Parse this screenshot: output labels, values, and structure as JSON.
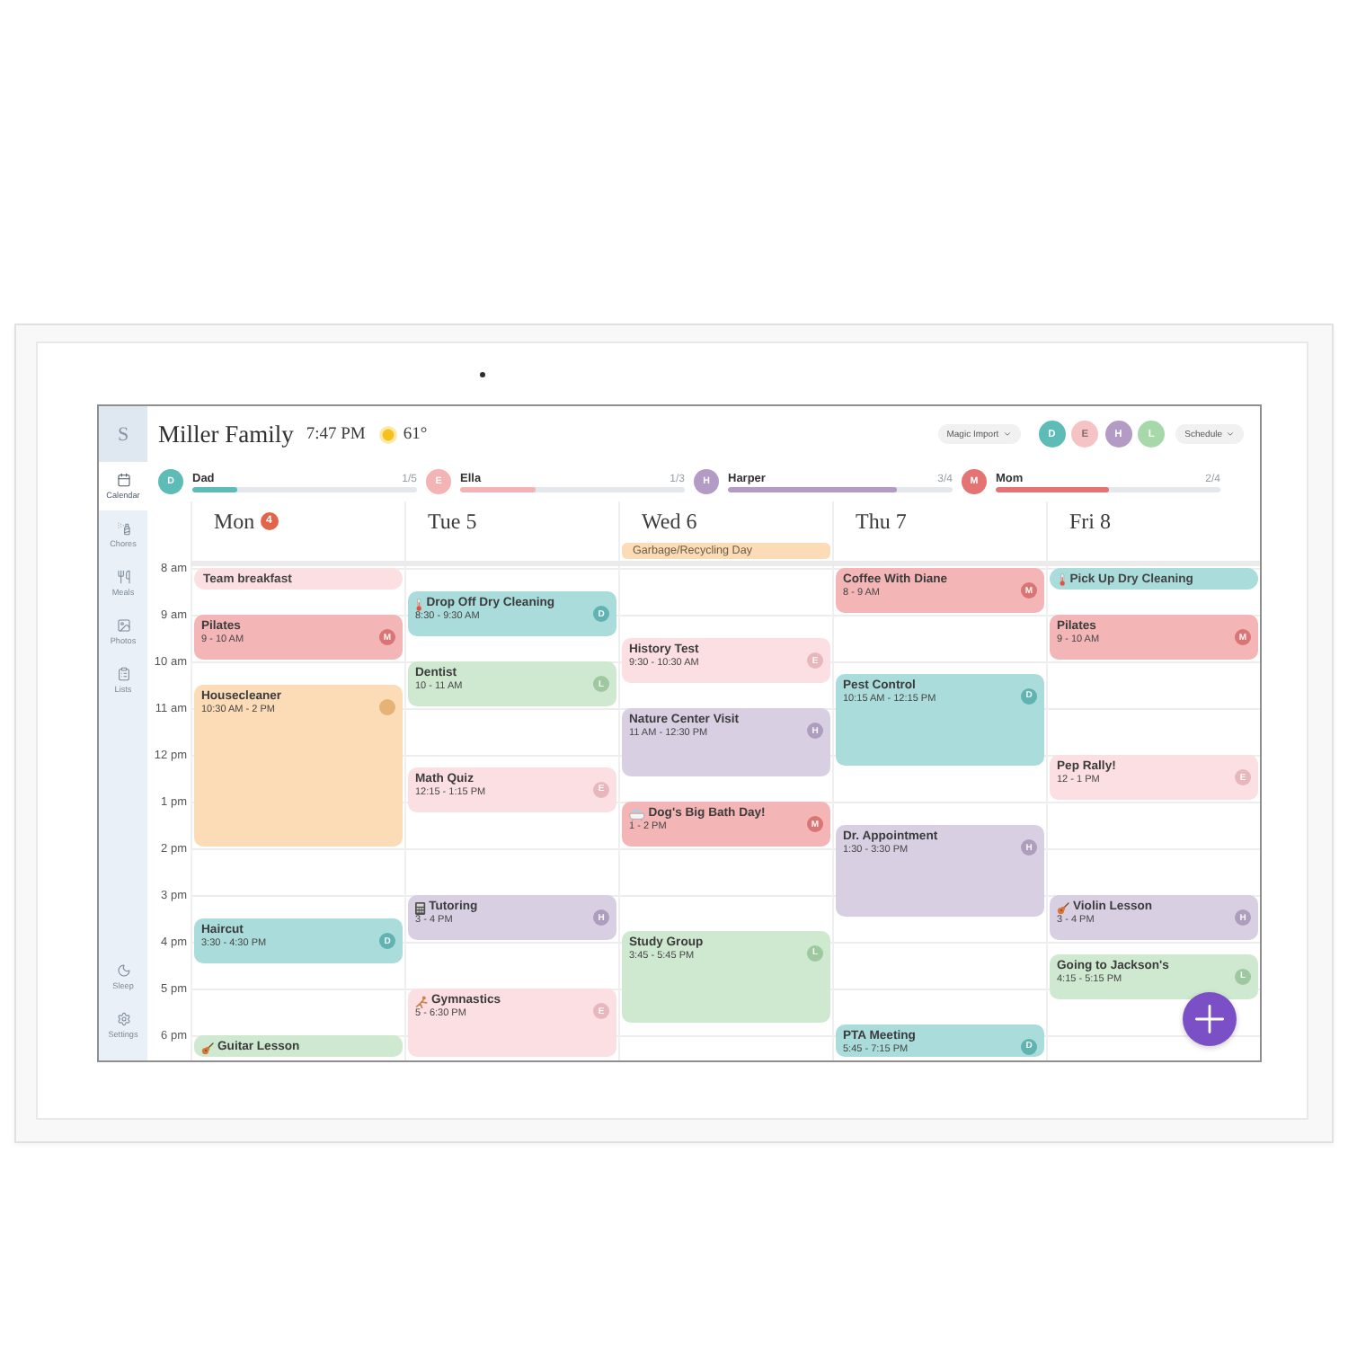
{
  "sidebar": {
    "logo": "S",
    "items": [
      {
        "label": "Calendar",
        "selected": true
      },
      {
        "label": "Chores",
        "selected": false
      },
      {
        "label": "Meals",
        "selected": false
      },
      {
        "label": "Photos",
        "selected": false
      },
      {
        "label": "Lists",
        "selected": false
      }
    ],
    "bottom_items": [
      {
        "label": "Sleep",
        "selected": false
      },
      {
        "label": "Settings",
        "selected": false
      }
    ]
  },
  "header": {
    "title": "Miller Family",
    "time": "7:47 PM",
    "temperature": "61°",
    "import_button": "Magic Import",
    "members": [
      {
        "initial": "D",
        "color": "#5dbdb6"
      },
      {
        "initial": "E",
        "color": "#f6c3c5"
      },
      {
        "initial": "H",
        "color": "#b39bc6"
      },
      {
        "initial": "L",
        "color": "#a7d8a9"
      }
    ],
    "view_selector": "Schedule"
  },
  "progress": [
    {
      "initial": "D",
      "name": "Dad",
      "count": "1/5",
      "level": 0.2,
      "color": "#5dbdb6"
    },
    {
      "initial": "E",
      "name": "Ella",
      "count": "1/3",
      "level": 0.333,
      "color": "#f4b3b5"
    },
    {
      "initial": "H",
      "name": "Harper",
      "count": "3/4",
      "level": 0.75,
      "color": "#b39bc6"
    },
    {
      "initial": "M",
      "name": "Mom",
      "count": "2/4",
      "level": 0.5,
      "color": "#e47474"
    }
  ],
  "hours": [
    "8 am",
    "9 am",
    "10 am",
    "11 am",
    "12 pm",
    "1 pm",
    "2 pm",
    "3 pm",
    "4 pm",
    "5 pm",
    "6 pm"
  ],
  "days": [
    {
      "label": "Mon",
      "badge": "4",
      "events": [
        {
          "kind": "short",
          "title": "Team breakfast",
          "color": "#fcdfe2"
        },
        {
          "kind": "timed",
          "title": "Pilates",
          "time": "9 - 10 AM",
          "avatar": "M",
          "color": "#f4b5b6"
        },
        {
          "kind": "timed",
          "title": "Housecleaner",
          "time": "10:30 AM - 2 PM",
          "color": "#fcdcb6"
        },
        {
          "kind": "timed",
          "title": "Haircut",
          "time": "3:30 - 4:30 PM",
          "avatar": "D",
          "color": "#a9dcdb"
        },
        {
          "kind": "partial",
          "title": "Guitar Lesson",
          "color": "#cfe9d0"
        }
      ]
    },
    {
      "label": "Tue 5",
      "events": [
        {
          "kind": "timed",
          "title": "Drop Off Dry Cleaning",
          "time": "8:30 - 9:30 AM",
          "avatar": "D",
          "color": "#a9dcdb"
        },
        {
          "kind": "timed",
          "title": "Dentist",
          "time": "10 - 11 AM",
          "avatar": "L",
          "color": "#cfe9d0"
        },
        {
          "kind": "timed",
          "title": "Math Quiz",
          "time": "12:15 - 1:15 PM",
          "avatar": "E",
          "color": "#fcdfe2"
        },
        {
          "kind": "timed",
          "title": "Tutoring",
          "time": "3 - 4 PM",
          "avatar": "H",
          "color": "#d9cfe2"
        },
        {
          "kind": "timed",
          "title": "Gymnastics",
          "time": "5 - 6:30 PM",
          "avatar": "E",
          "color": "#fcdfe2"
        }
      ]
    },
    {
      "label": "Wed 6",
      "all_day": [
        {
          "title": "Garbage/Recycling Day",
          "color": "#fcdcb6"
        }
      ],
      "events": [
        {
          "kind": "timed",
          "title": "History Test",
          "time": "9:30 - 10:30 AM",
          "avatar": "E",
          "color": "#fcdfe2"
        },
        {
          "kind": "timed",
          "title": "Nature Center Visit",
          "time": "11 AM - 12:30 PM",
          "avatar": "H",
          "color": "#d9cfe2"
        },
        {
          "kind": "timed",
          "title": "Dog's Big Bath Day!",
          "time": "1 - 2 PM",
          "avatar": "M",
          "color": "#f4b5b6"
        },
        {
          "kind": "timed",
          "title": "Study Group",
          "time": "3:45 - 5:45 PM",
          "avatar": "L",
          "color": "#cfe9d0"
        }
      ]
    },
    {
      "label": "Thu 7",
      "events": [
        {
          "kind": "timed",
          "title": "Coffee With Diane",
          "time": "8 - 9 AM",
          "avatar": "M",
          "color": "#f4b5b6"
        },
        {
          "kind": "timed",
          "title": "Pest Control",
          "time": "10:15 AM - 12:15 PM",
          "avatar": "D",
          "color": "#a9dcdb"
        },
        {
          "kind": "timed",
          "title": "Dr. Appointment",
          "time": "1:30 - 3:30 PM",
          "avatar": "H",
          "color": "#d9cfe2"
        },
        {
          "kind": "timed",
          "title": "PTA Meeting",
          "time": "5:45 - 7:15 PM",
          "avatar": "D",
          "color": "#a9dcdb"
        }
      ]
    },
    {
      "label": "Fri 8",
      "events": [
        {
          "kind": "short",
          "title": "Pick Up Dry Cleaning",
          "color": "#a9dcdb"
        },
        {
          "kind": "timed",
          "title": "Pilates",
          "time": "9 - 10 AM",
          "avatar": "M",
          "color": "#f4b5b6"
        },
        {
          "kind": "timed",
          "title": "Pep Rally!",
          "time": "12 - 1 PM",
          "avatar": "E",
          "color": "#fcdfe2"
        },
        {
          "kind": "timed",
          "title": "Violin Lesson",
          "time": "3 - 4 PM",
          "avatar": "H",
          "color": "#d9cfe2"
        },
        {
          "kind": "timed",
          "title": "Going to Jackson's",
          "time": "4:15 - 5:15 PM",
          "avatar": "L",
          "color": "#cfe9d0"
        }
      ]
    }
  ]
}
